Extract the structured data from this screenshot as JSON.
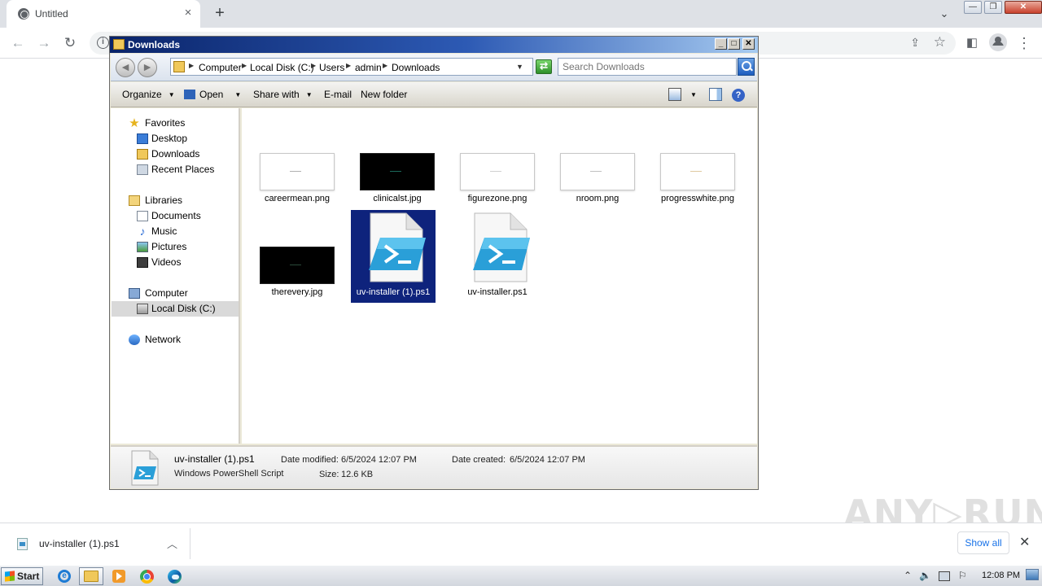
{
  "browser": {
    "tab_title": "Untitled",
    "tab_close": "×",
    "new_tab": "+",
    "tab_menu": "⌄",
    "window_controls": {
      "minimize": "—",
      "restore": "❐",
      "close": "✕"
    },
    "back": "←",
    "forward": "→",
    "reload": "↻",
    "info_glyph": "i",
    "share_glyph": "⇪",
    "star_glyph": "☆",
    "sidebar_glyph": "◧",
    "menu_glyph": "⋮"
  },
  "explorer": {
    "title": "Downloads",
    "title_buttons": {
      "minimize": "_",
      "maximize": "□",
      "close": "✕"
    },
    "back_glyph": "◄",
    "forward_glyph": "►",
    "breadcrumb": [
      "Computer",
      "Local Disk (C:)",
      "Users",
      "admin",
      "Downloads"
    ],
    "refresh_glyph": "⇄",
    "search_placeholder": "Search Downloads",
    "toolbar": {
      "organize": "Organize",
      "open": "Open",
      "share_with": "Share with",
      "email": "E-mail",
      "new_folder": "New folder",
      "dropdown_glyph": "▼",
      "help_glyph": "?"
    },
    "nav": {
      "favorites": "Favorites",
      "desktop": "Desktop",
      "downloads": "Downloads",
      "recent_places": "Recent Places",
      "libraries": "Libraries",
      "documents": "Documents",
      "music": "Music",
      "pictures": "Pictures",
      "videos": "Videos",
      "computer": "Computer",
      "local_disk": "Local Disk (C:)",
      "network": "Network"
    },
    "files": [
      {
        "name": "careermean.png",
        "thumb": "white",
        "mark_color": "#b0b0b0"
      },
      {
        "name": "clinicalst.jpg",
        "thumb": "black",
        "mark_color": "#1c6b5c"
      },
      {
        "name": "figurezone.png",
        "thumb": "white",
        "mark_color": "#d0d0d0"
      },
      {
        "name": "nroom.png",
        "thumb": "white",
        "mark_color": "#c0c0c0"
      },
      {
        "name": "progresswhite.png",
        "thumb": "white",
        "mark_color": "#e0c9a0"
      },
      {
        "name": "therevery.jpg",
        "thumb": "black",
        "mark_color": "#2a4a3a"
      },
      {
        "name": "uv-installer (1).ps1",
        "type": "ps1",
        "selected": true
      },
      {
        "name": "uv-installer.ps1",
        "type": "ps1"
      }
    ],
    "details": {
      "file_name": "uv-installer (1).ps1",
      "file_type": "Windows PowerShell Script",
      "date_modified_label": "Date modified:",
      "date_modified": "6/5/2024 12:07 PM",
      "date_created_label": "Date created:",
      "date_created": "6/5/2024 12:07 PM",
      "size_label": "Size:",
      "size": "12.6 KB"
    }
  },
  "download_shelf": {
    "file_name": "uv-installer (1).ps1",
    "chevron": "︿",
    "show_all": "Show all",
    "close": "✕"
  },
  "watermark": "ANY▷RUN",
  "taskbar": {
    "start": "Start",
    "ie_glyph": "e",
    "clock": "12:08 PM",
    "tray": {
      "up": "⌃",
      "volume": "🔈",
      "flag": "⚐"
    }
  },
  "colors": {
    "selection": "#0e237c",
    "title_gradient_start": "#0a246a",
    "chrome_link": "#1a73e8"
  }
}
